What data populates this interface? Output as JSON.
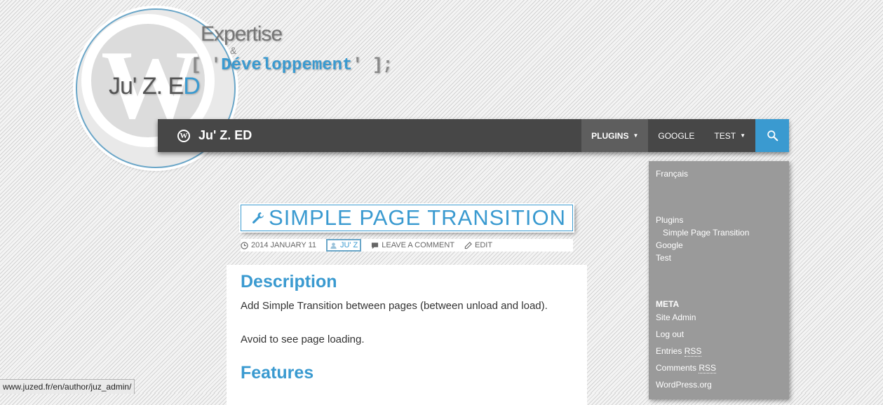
{
  "logo": {
    "name_prefix": "Ju' Z. E",
    "name_suffix": "D",
    "tagline_top": "Expertise",
    "tagline_amp": "&",
    "tagline_code_open": "[ '",
    "tagline_code_word": "Développement",
    "tagline_code_close": "' ];"
  },
  "navbar": {
    "brand": "Ju' Z. ED",
    "items": [
      {
        "label": "PLUGINS",
        "active": true,
        "dropdown": true
      },
      {
        "label": "GOOGLE",
        "active": false,
        "dropdown": false
      },
      {
        "label": "TEST",
        "active": false,
        "dropdown": true
      }
    ]
  },
  "sidebar": {
    "language": "Français",
    "menu": [
      "Plugins",
      "Simple Page Transition",
      "Google",
      "Test"
    ],
    "meta_heading": "META",
    "meta_links": [
      "Site Admin",
      "Log out"
    ],
    "entries_rss_prefix": "Entries ",
    "comments_rss_prefix": "Comments ",
    "rss": "RSS",
    "wordpress": "WordPress.org"
  },
  "entry": {
    "title": "SIMPLE PAGE TRANSITION",
    "date": "2014 JANUARY 11",
    "author": "JU' Z",
    "comment": "LEAVE A COMMENT",
    "edit": "EDIT"
  },
  "content": {
    "h_description": "Description",
    "p1": "Add Simple Transition between pages (between unload and load).",
    "p2": "Avoid to see page loading.",
    "h_features": "Features"
  },
  "status_url": "www.juzed.fr/en/author/juz_admin/",
  "colors": {
    "accent": "#3a9ad0",
    "navbar": "#474747",
    "sidebar": "#9a9a9a"
  }
}
